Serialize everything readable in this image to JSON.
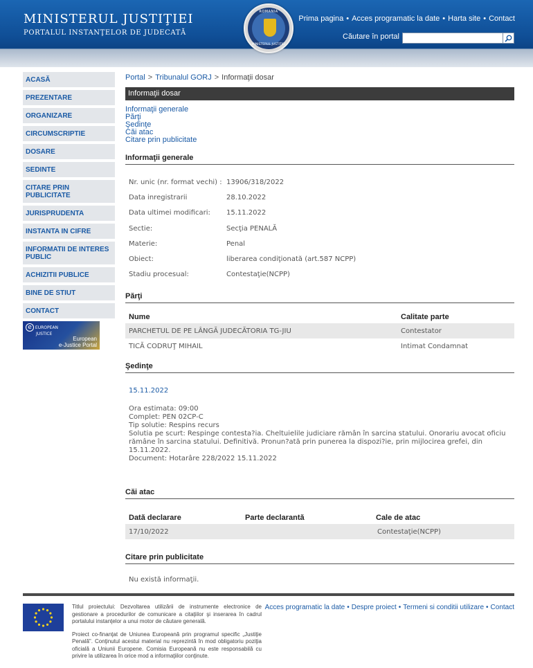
{
  "header": {
    "title": "MINISTERUL JUSTIŢIEI",
    "subtitle": "PORTALUL INSTANŢELOR DE JUDECATĂ",
    "seal_top": "ROMANIA",
    "seal_bottom": "MINISTERUL JUSTIŢIEI",
    "nav": [
      "Prima pagina",
      "Acces programatic la date",
      "Harta site",
      "Contact"
    ],
    "search_label": "Căutare în portal",
    "search_value": ""
  },
  "sidebar": {
    "items": [
      {
        "label": "ACASĂ"
      },
      {
        "label": "PREZENTARE"
      },
      {
        "label": "ORGANIZARE"
      },
      {
        "label": "CIRCUMSCRIPTIE"
      },
      {
        "label": "DOSARE"
      },
      {
        "label": "SEDINTE"
      },
      {
        "label": "CITARE PRIN PUBLICITATE"
      },
      {
        "label": "JURISPRUDENTA"
      },
      {
        "label": "INSTANTA IN CIFRE"
      },
      {
        "label": "INFORMATII DE INTERES PUBLIC"
      },
      {
        "label": "ACHIZITII PUBLICE"
      },
      {
        "label": "BINE DE STIUT"
      },
      {
        "label": "CONTACT"
      }
    ],
    "banner": {
      "logo_line1": "EUROPEAN",
      "logo_line2": "JUSTICE",
      "line1": "European",
      "line2": "e-Justice Portal"
    }
  },
  "breadcrumb": {
    "portal": "Portal",
    "court": "Tribunalul GORJ",
    "current": "Informaţii dosar"
  },
  "page_title": "Informaţii dosar",
  "toc": [
    "Informaţii generale",
    "Părţi",
    "Şedinţe",
    "Căi atac",
    "Citare prin publicitate"
  ],
  "general": {
    "title": "Informaţii generale",
    "rows": [
      {
        "k": "Nr. unic (nr. format vechi) :",
        "v": "13906/318/2022"
      },
      {
        "k": "Data inregistrarii",
        "v": "28.10.2022"
      },
      {
        "k": "Data ultimei modificari:",
        "v": "15.11.2022"
      },
      {
        "k": "Sectie:",
        "v": "Secţia PENALĂ"
      },
      {
        "k": "Materie:",
        "v": "Penal"
      },
      {
        "k": "Obiect:",
        "v": "liberarea condiţionată (art.587 NCPP)"
      },
      {
        "k": "Stadiu procesual:",
        "v": "Contestaţie(NCPP)"
      }
    ]
  },
  "parti": {
    "title": "Părţi",
    "headers": [
      "Nume",
      "Calitate parte"
    ],
    "rows": [
      {
        "nume": "PARCHETUL DE PE LÂNGĂ JUDECĂTORIA TG-JIU",
        "calitate": "Contestator"
      },
      {
        "nume": "TICĂ CODRUŢ MIHAIL",
        "calitate": "Intimat Condamnat"
      }
    ]
  },
  "sedinte": {
    "title": "Şedinţe",
    "date": "15.11.2022",
    "ora": "Ora estimata: 09:00",
    "complet": "Complet: PEN 02CP-C",
    "tip": "Tip solutie: Respins recurs",
    "solutia": "Solutia pe scurt: Respinge contesta?ia. Cheltuielile judiciare rămân în sarcina statului. Onorariu avocat oficiu rămâne în sarcina statului. Definitivă. Pronun?ată prin punerea la dispozi?ie, prin mijlocirea grefei, din 15.11.2022.",
    "document": "Document: Hotarâre  228/2022  15.11.2022"
  },
  "cai_atac": {
    "title": "Căi atac",
    "headers": [
      "Dată declarare",
      "Parte declarantă",
      "Cale de atac"
    ],
    "rows": [
      {
        "data": "17/10/2022",
        "parte": "",
        "cale": "Contestaţie(NCPP)"
      }
    ]
  },
  "citare": {
    "title": "Citare prin publicitate",
    "empty": "Nu există informaţii."
  },
  "footer": {
    "text1": "Titlul proiectului: Dezvoltarea utilizării de instrumente electronice de gestionare a procedurilor de comunicare a citaţiilor şi inserarea în cadrul portalului instanţelor a unui motor de căutare generală.",
    "text2": "Proiect co-finanţat de Uniunea Europeană prin programul specific „Justiţie Penală\". Conţinutul acestui material nu reprezintă în mod obligatoriu poziţia oficială a Uniunii Europene. Comisia Europeană nu este responsabilă cu privire la utilizarea în orice mod a informaţiilor conţinute.",
    "links": [
      "Acces programatic la date",
      "Despre proiect",
      "Termeni si conditii utilizare",
      "Contact"
    ]
  },
  "colors": {
    "link": "#1a5aa5",
    "header_blue": "#0f4e96",
    "dark_bar": "#3c3c3c",
    "sidebar_bg": "#e3e6ea"
  }
}
